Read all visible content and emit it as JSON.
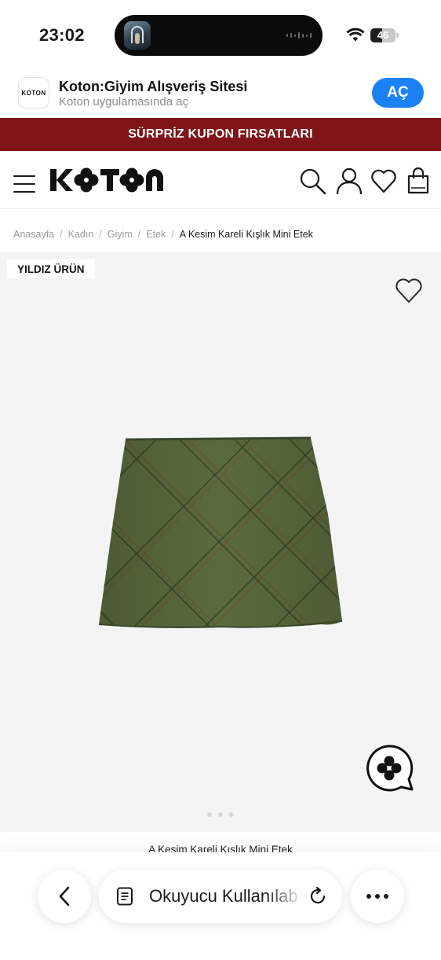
{
  "status_bar": {
    "time": "23:02",
    "battery": 46,
    "battery_label": "46"
  },
  "app_banner": {
    "icon_text": "KOTON",
    "title": "Koton:Giyim Alışveriş Sitesi",
    "subtitle": "Koton uygulamasında aç",
    "open_label": "AÇ",
    "accent": "#1a82f5"
  },
  "promo": {
    "text": "SÜRPRİZ KUPON FIRSATLARI",
    "color": "#7f1518"
  },
  "header": {
    "icons": [
      "menu-icon",
      "koton-logo",
      "search-icon",
      "account-icon",
      "heart-icon",
      "bag-icon"
    ]
  },
  "breadcrumb": {
    "items": [
      "Anasayfa",
      "Kadın",
      "Giyim",
      "Etek"
    ],
    "current": "A Kesim Kareli Kışlık Mini Etek"
  },
  "product": {
    "badge": "YILDIZ ÜRÜN",
    "title": "A Kesim Kareli Kışlık Mini Etek",
    "image": "green-plaid-mini-skirt",
    "skirt_color": "#5a6b3e"
  },
  "browser_bar": {
    "address_text": "Okuyucu Kullanılabilir",
    "icons": [
      "back-icon",
      "reader-icon",
      "reload-icon",
      "more-icon"
    ]
  }
}
